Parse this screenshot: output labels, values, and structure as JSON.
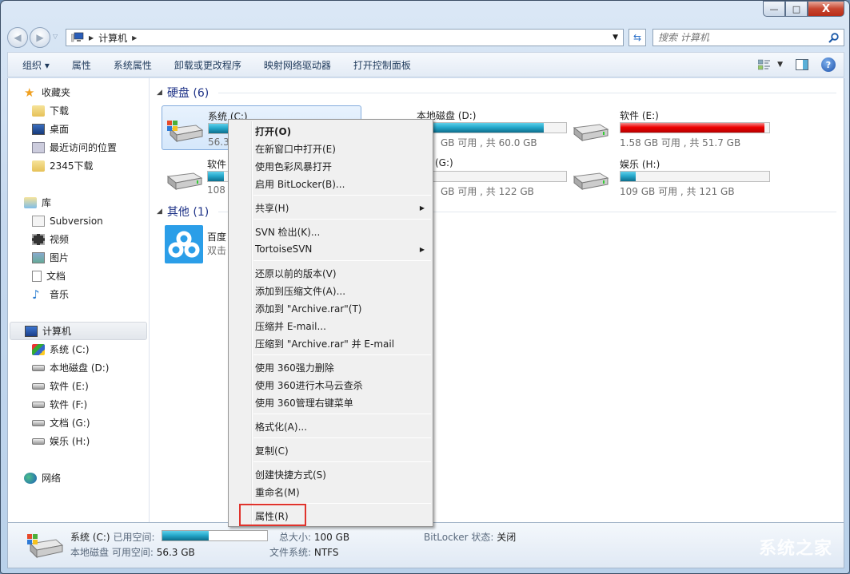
{
  "window": {
    "minimize": "—",
    "maximize": "□",
    "close": "X"
  },
  "nav": {
    "back_icon": "back-arrow",
    "forward_icon": "forward-arrow"
  },
  "address": {
    "root_icon": "computer-icon",
    "path": [
      "计算机"
    ]
  },
  "search": {
    "placeholder": "搜索 计算机"
  },
  "toolbar": {
    "items": [
      "组织 ▾",
      "属性",
      "系统属性",
      "卸载或更改程序",
      "映射网络驱动器",
      "打开控制面板"
    ]
  },
  "sidebar": {
    "favorites": {
      "label": "收藏夹",
      "items": [
        "下载",
        "桌面",
        "最近访问的位置",
        "2345下载"
      ]
    },
    "libraries": {
      "label": "库",
      "items": [
        "Subversion",
        "视频",
        "图片",
        "文档",
        "音乐"
      ]
    },
    "computer": {
      "label": "计算机",
      "items": [
        "系统 (C:)",
        "本地磁盘 (D:)",
        "软件 (E:)",
        "软件 (F:)",
        "文档 (G:)",
        "娱乐 (H:)"
      ]
    },
    "network": {
      "label": "网络"
    }
  },
  "groups": {
    "hdd": {
      "label": "硬盘 (6)"
    },
    "other": {
      "label": "其他 (1)"
    }
  },
  "drives": [
    {
      "name": "系统 (C:)",
      "info": "56.3",
      "used_fraction": 0.44,
      "color": "blue"
    },
    {
      "name": "本地磁盘 (D:)",
      "info": "GB 可用 , 共 60.0 GB",
      "used_fraction": 0.85,
      "color": "blue"
    },
    {
      "name": "软件 (E:)",
      "info": "1.58 GB 可用 , 共 51.7 GB",
      "used_fraction": 0.97,
      "color": "red"
    },
    {
      "name": "软件",
      "info": "108",
      "used_fraction": 0.11,
      "color": "blue"
    },
    {
      "name": "(G:)",
      "info": "GB 可用 , 共 122 GB",
      "used_fraction": 0.0,
      "color": "blue"
    },
    {
      "name": "娱乐 (H:)",
      "info": "109 GB 可用 , 共 121 GB",
      "used_fraction": 0.1,
      "color": "blue"
    }
  ],
  "other_items": [
    {
      "name": "百度",
      "desc": "双击"
    }
  ],
  "context_menu": {
    "items": [
      {
        "label": "打开(O)",
        "bold": true
      },
      {
        "label": "在新窗口中打开(E)"
      },
      {
        "label": "使用色彩风暴打开"
      },
      {
        "label": "启用 BitLocker(B)...",
        "icon": "shield-icon"
      },
      {
        "label": "共享(H)",
        "submenu": true
      },
      {
        "label": "SVN 检出(K)...",
        "icon": "svn-checkout-icon"
      },
      {
        "label": "TortoiseSVN",
        "icon": "tortoise-icon",
        "submenu": true
      },
      {
        "label": "还原以前的版本(V)"
      },
      {
        "label": "添加到压缩文件(A)...",
        "icon": "winrar-icon"
      },
      {
        "label": "添加到 \"Archive.rar\"(T)",
        "icon": "winrar-icon"
      },
      {
        "label": "压缩并 E-mail...",
        "icon": "winrar-icon"
      },
      {
        "label": "压缩到 \"Archive.rar\" 并 E-mail",
        "icon": "winrar-icon"
      },
      {
        "label": "使用 360强力删除",
        "icon": "360-delete-icon"
      },
      {
        "label": "使用 360进行木马云查杀",
        "icon": "360-icon"
      },
      {
        "label": "使用 360管理右键菜单",
        "icon": "360-icon"
      },
      {
        "label": "格式化(A)..."
      },
      {
        "label": "复制(C)"
      },
      {
        "label": "创建快捷方式(S)"
      },
      {
        "label": "重命名(M)"
      },
      {
        "label": "属性(R)",
        "highlighted": true
      }
    ]
  },
  "status": {
    "name": "系统 (C:)",
    "type": "本地磁盘",
    "used_label": "已用空间:",
    "used_fraction": 0.44,
    "free_label": "可用空间:",
    "free_value": "56.3 GB",
    "total_label": "总大小:",
    "total_value": "100 GB",
    "fs_label": "文件系统:",
    "fs_value": "NTFS",
    "bitlocker_label": "BitLocker 状态:",
    "bitlocker_value": "关闭"
  },
  "watermark": "系统之家"
}
